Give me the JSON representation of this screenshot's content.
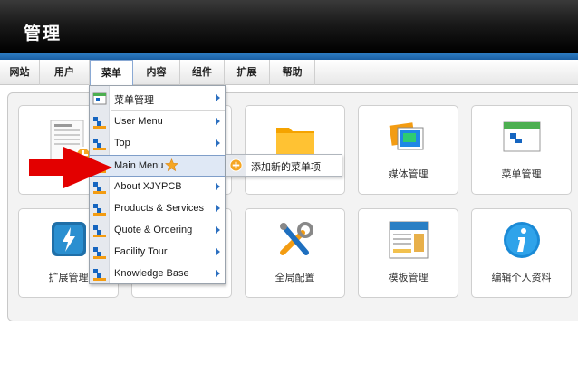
{
  "header": {
    "title": "管理"
  },
  "nav": {
    "items": [
      {
        "label": "网站"
      },
      {
        "label": "用户"
      },
      {
        "label": "菜单"
      },
      {
        "label": "内容"
      },
      {
        "label": "组件"
      },
      {
        "label": "扩展"
      },
      {
        "label": "帮助"
      }
    ]
  },
  "tiles": [
    {
      "label": "",
      "icon": "article-icon"
    },
    {
      "label": "媒体管理",
      "icon": "media-manager-icon"
    },
    {
      "label": "菜单管理",
      "icon": "menu-manager-icon"
    },
    {
      "label": "扩展管理",
      "icon": "extension-manager-icon"
    },
    {
      "label": "全局配置",
      "icon": "global-config-icon"
    },
    {
      "label": "模板管理",
      "icon": "template-manager-icon"
    },
    {
      "label": "编辑个人资料",
      "icon": "edit-profile-icon"
    }
  ],
  "menu_dropdown": {
    "items": [
      {
        "label": "菜单管理"
      },
      {
        "label": "User Menu"
      },
      {
        "label": "Top"
      },
      {
        "label": "Main Menu"
      },
      {
        "label": "About XJYPCB"
      },
      {
        "label": "Products & Services"
      },
      {
        "label": "Quote & Ordering"
      },
      {
        "label": "Facility Tour"
      },
      {
        "label": "Knowledge Base"
      }
    ],
    "hovered": "Main Menu"
  },
  "submenu": {
    "add_item": "添加新的菜单项"
  },
  "colors": {
    "header_bg": "#000000",
    "accent_blue": "#2f7fc6",
    "hover_bg": "#dfe8f5",
    "arrow_red": "#e30000"
  }
}
